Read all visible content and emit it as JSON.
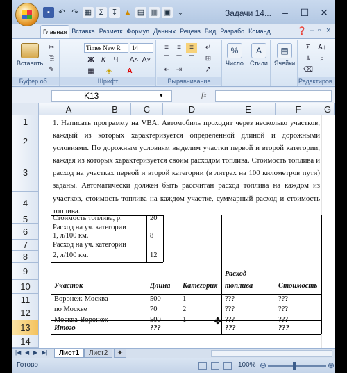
{
  "window": {
    "title": "Задачи 14..."
  },
  "ribbon": {
    "tabs": [
      "Главная",
      "Вставка",
      "Разметк",
      "Формул",
      "Данных",
      "Реценз",
      "Вид",
      "Разрабо",
      "Команд"
    ],
    "groups": {
      "clipboard": {
        "label": "Буфер об...",
        "paste": "Вставить"
      },
      "font": {
        "label": "Шрифт",
        "font_name": "Times New R",
        "font_size": "14"
      },
      "alignment": {
        "label": "Выравнивание"
      },
      "number": {
        "label": "Число"
      },
      "styles": {
        "label": "Стили"
      },
      "cells": {
        "label": "Ячейки"
      },
      "editing": {
        "label": "Редактиров..."
      }
    }
  },
  "formula_bar": {
    "name_box": "K13",
    "fx": "fx",
    "formula": ""
  },
  "columns": [
    "A",
    "B",
    "C",
    "D",
    "E",
    "F",
    "G"
  ],
  "rows": [
    "1",
    "2",
    "3",
    "4",
    "5",
    "6",
    "7",
    "8",
    "9",
    "10",
    "11",
    "12",
    "13",
    "14"
  ],
  "selected_row": "13",
  "task_text": "1. Написать программу на VBA. Автомобиль проходит через несколько участков, каждый из которых характеризуется определённой длиной и дорожными условиями. По дорожным условиям выделим участки первой и второй категории, каждая из которых характеризуется своим расходом топлива. Стоимость топлива и расход на участках первой и второй категории (в литрах на 100 километров пути) заданы. Автоматически должен быть рассчитан расход топлива на каждом из участков, стоимость топлива на каждом участке, суммарный расход и стоимость топлива.",
  "params": [
    {
      "label": "Стоимость топлива, р.",
      "value": "20"
    },
    {
      "label": "Расход на уч. категории",
      "label2": "1, л/100 км.",
      "value": "8"
    },
    {
      "label": "Расход на уч. категории",
      "label2": "2, л/100 км.",
      "value": "12"
    }
  ],
  "table": {
    "headers": {
      "route": "Участок",
      "length": "Длина",
      "category": "Категория",
      "consumption_1": "Расход",
      "consumption_2": "топлива",
      "cost": "Стоимость"
    },
    "rows": [
      {
        "route": "Воронеж-Москва",
        "length": "500",
        "category": "1",
        "consumption": "???",
        "cost": "???"
      },
      {
        "route": "по Москве",
        "length": "70",
        "category": "2",
        "consumption": "???",
        "cost": "???"
      },
      {
        "route": "Москва-Воронеж",
        "length": "500",
        "category": "1",
        "consumption": "???",
        "cost": "???"
      }
    ],
    "total": {
      "label": "Итого",
      "length": "???",
      "consumption": "???",
      "cost": "???"
    }
  },
  "sheets": [
    "Лист1",
    "Лист2"
  ],
  "active_sheet": "Лист1",
  "status": {
    "text": "Готово",
    "zoom": "100%"
  }
}
